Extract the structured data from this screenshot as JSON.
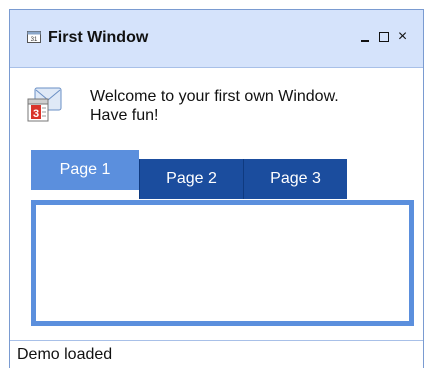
{
  "window": {
    "title": "First Window",
    "controls": {
      "minimize": "_",
      "maximize": "□",
      "close": "×"
    }
  },
  "content": {
    "welcome_line1": "Welcome to your first own Window.",
    "welcome_line2": "Have fun!",
    "calendar_day": "3",
    "title_icon_day": "31"
  },
  "tabs": [
    {
      "label": "Page 1",
      "selected": true
    },
    {
      "label": "Page 2",
      "selected": false
    },
    {
      "label": "Page 3",
      "selected": false
    }
  ],
  "status": {
    "text": "Demo loaded"
  },
  "colors": {
    "titlebar_bg": "#d5e3fb",
    "active_tab": "#5b8fdd",
    "inactive_tab": "#1b4d9e"
  }
}
